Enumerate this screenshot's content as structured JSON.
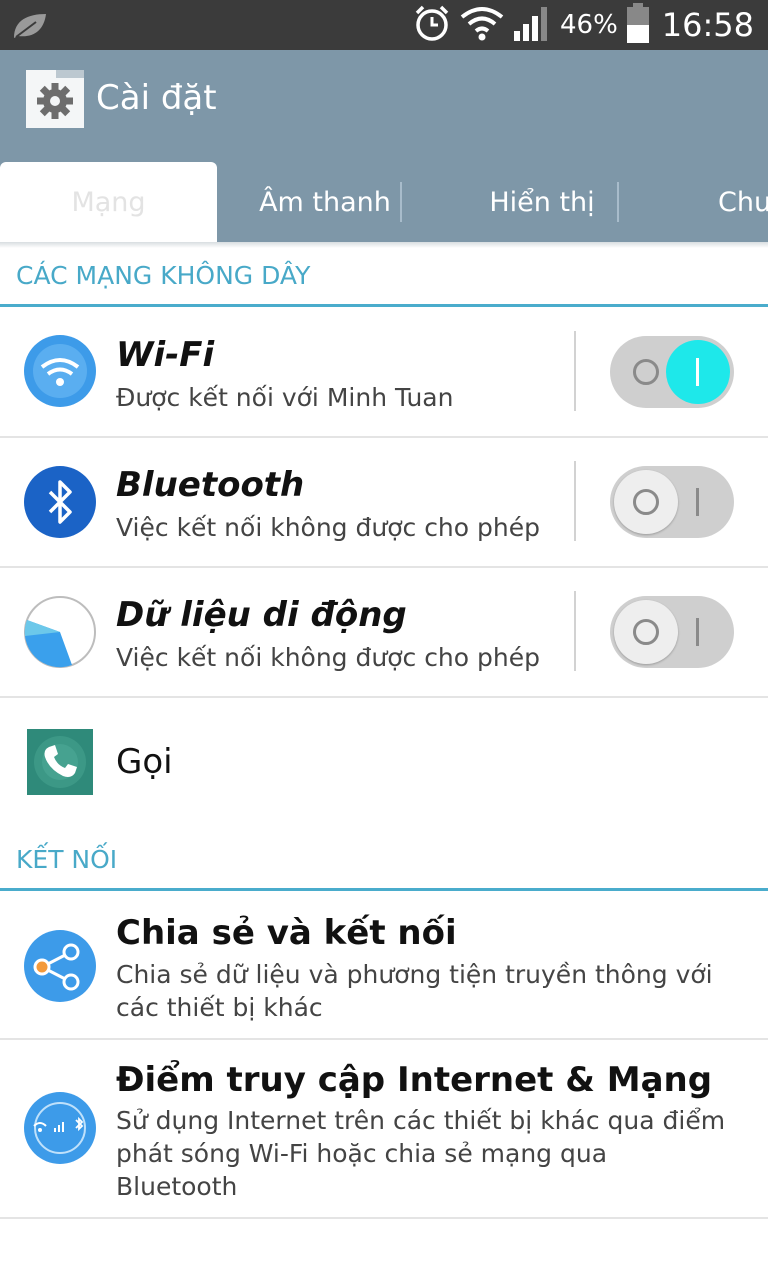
{
  "status_bar": {
    "battery_percent": "46%",
    "time": "16:58",
    "icons": [
      "leaf-icon",
      "alarm-icon",
      "wifi-icon",
      "signal-icon",
      "battery-icon"
    ]
  },
  "app_bar": {
    "title": "Cài đặt",
    "icon": "settings-gear-icon"
  },
  "tabs": [
    {
      "label": "Mạng",
      "active": true
    },
    {
      "label": "Âm thanh",
      "active": false
    },
    {
      "label": "Hiển thị",
      "active": false
    },
    {
      "label": "Chu",
      "active": false
    }
  ],
  "sections": {
    "wireless": {
      "header": "CÁC MẠNG KHÔNG DÂY",
      "items": [
        {
          "title": "Wi-Fi",
          "subtitle": "Được kết nối với Minh Tuan",
          "toggle": true,
          "icon": "wifi-icon"
        },
        {
          "title": "Bluetooth",
          "subtitle": "Việc kết nối không được cho phép",
          "toggle": false,
          "icon": "bluetooth-icon"
        },
        {
          "title": "Dữ liệu di động",
          "subtitle": "Việc kết nối không được cho phép",
          "toggle": false,
          "icon": "mobile-data-pie-icon"
        },
        {
          "title": "Gọi",
          "icon": "phone-icon"
        }
      ]
    },
    "connect": {
      "header": "KẾT NỐI",
      "items": [
        {
          "title": "Chia sẻ và kết nối",
          "subtitle": "Chia sẻ dữ liệu và phương tiện truyền thông với các thiết bị khác",
          "icon": "share-icon"
        },
        {
          "title": "Điểm truy cập Internet & Mạng",
          "subtitle": "Sử dụng Internet trên các thiết bị khác qua điểm phát sóng Wi-Fi hoặc chia sẻ mạng qua Bluetooth",
          "icon": "hotspot-icon"
        }
      ]
    }
  },
  "colors": {
    "status_bar": "#3b3b3b",
    "app_bar": "#7e97a8",
    "section_header": "#48a9c8",
    "toggle_on": "#1ee8ea"
  }
}
